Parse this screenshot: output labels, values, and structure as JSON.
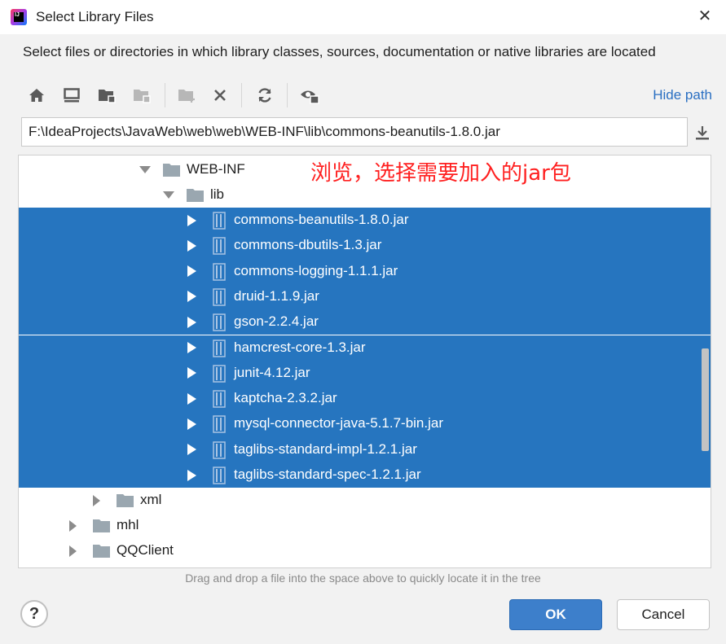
{
  "window": {
    "title": "Select Library Files",
    "close_label": "✕"
  },
  "description": "Select files or directories in which library classes, sources, documentation or native libraries are located",
  "toolbar": {
    "buttons": [
      "home-icon",
      "desktop-icon",
      "project-folder-icon",
      "module-folder-icon",
      "new-folder-icon",
      "delete-icon",
      "refresh-icon",
      "show-hidden-icon"
    ],
    "hide_path_label": "Hide path"
  },
  "path": {
    "value": "F:\\IdeaProjects\\JavaWeb\\web\\web\\WEB-INF\\lib\\commons-beanutils-1.8.0.jar"
  },
  "tree": {
    "annotation": "浏览，选择需要加入的jar包",
    "web_inf": "WEB-INF",
    "lib": "lib",
    "jars": [
      "commons-beanutils-1.8.0.jar",
      "commons-dbutils-1.3.jar",
      "commons-logging-1.1.1.jar",
      "druid-1.1.9.jar",
      "gson-2.2.4.jar",
      "hamcrest-core-1.3.jar",
      "junit-4.12.jar",
      "kaptcha-2.3.2.jar",
      "mysql-connector-java-5.1.7-bin.jar",
      "taglibs-standard-impl-1.2.1.jar",
      "taglibs-standard-spec-1.2.1.jar"
    ],
    "xml": "xml",
    "mhl": "mhl",
    "qqclient": "QQClient"
  },
  "hint": "Drag and drop a file into the space above to quickly locate it in the tree",
  "buttons": {
    "help": "?",
    "ok": "OK",
    "cancel": "Cancel"
  },
  "colors": {
    "selection": "#2675bf",
    "annotation": "#ff2020",
    "link": "#2a6fc2",
    "ok": "#3d7fcb"
  }
}
